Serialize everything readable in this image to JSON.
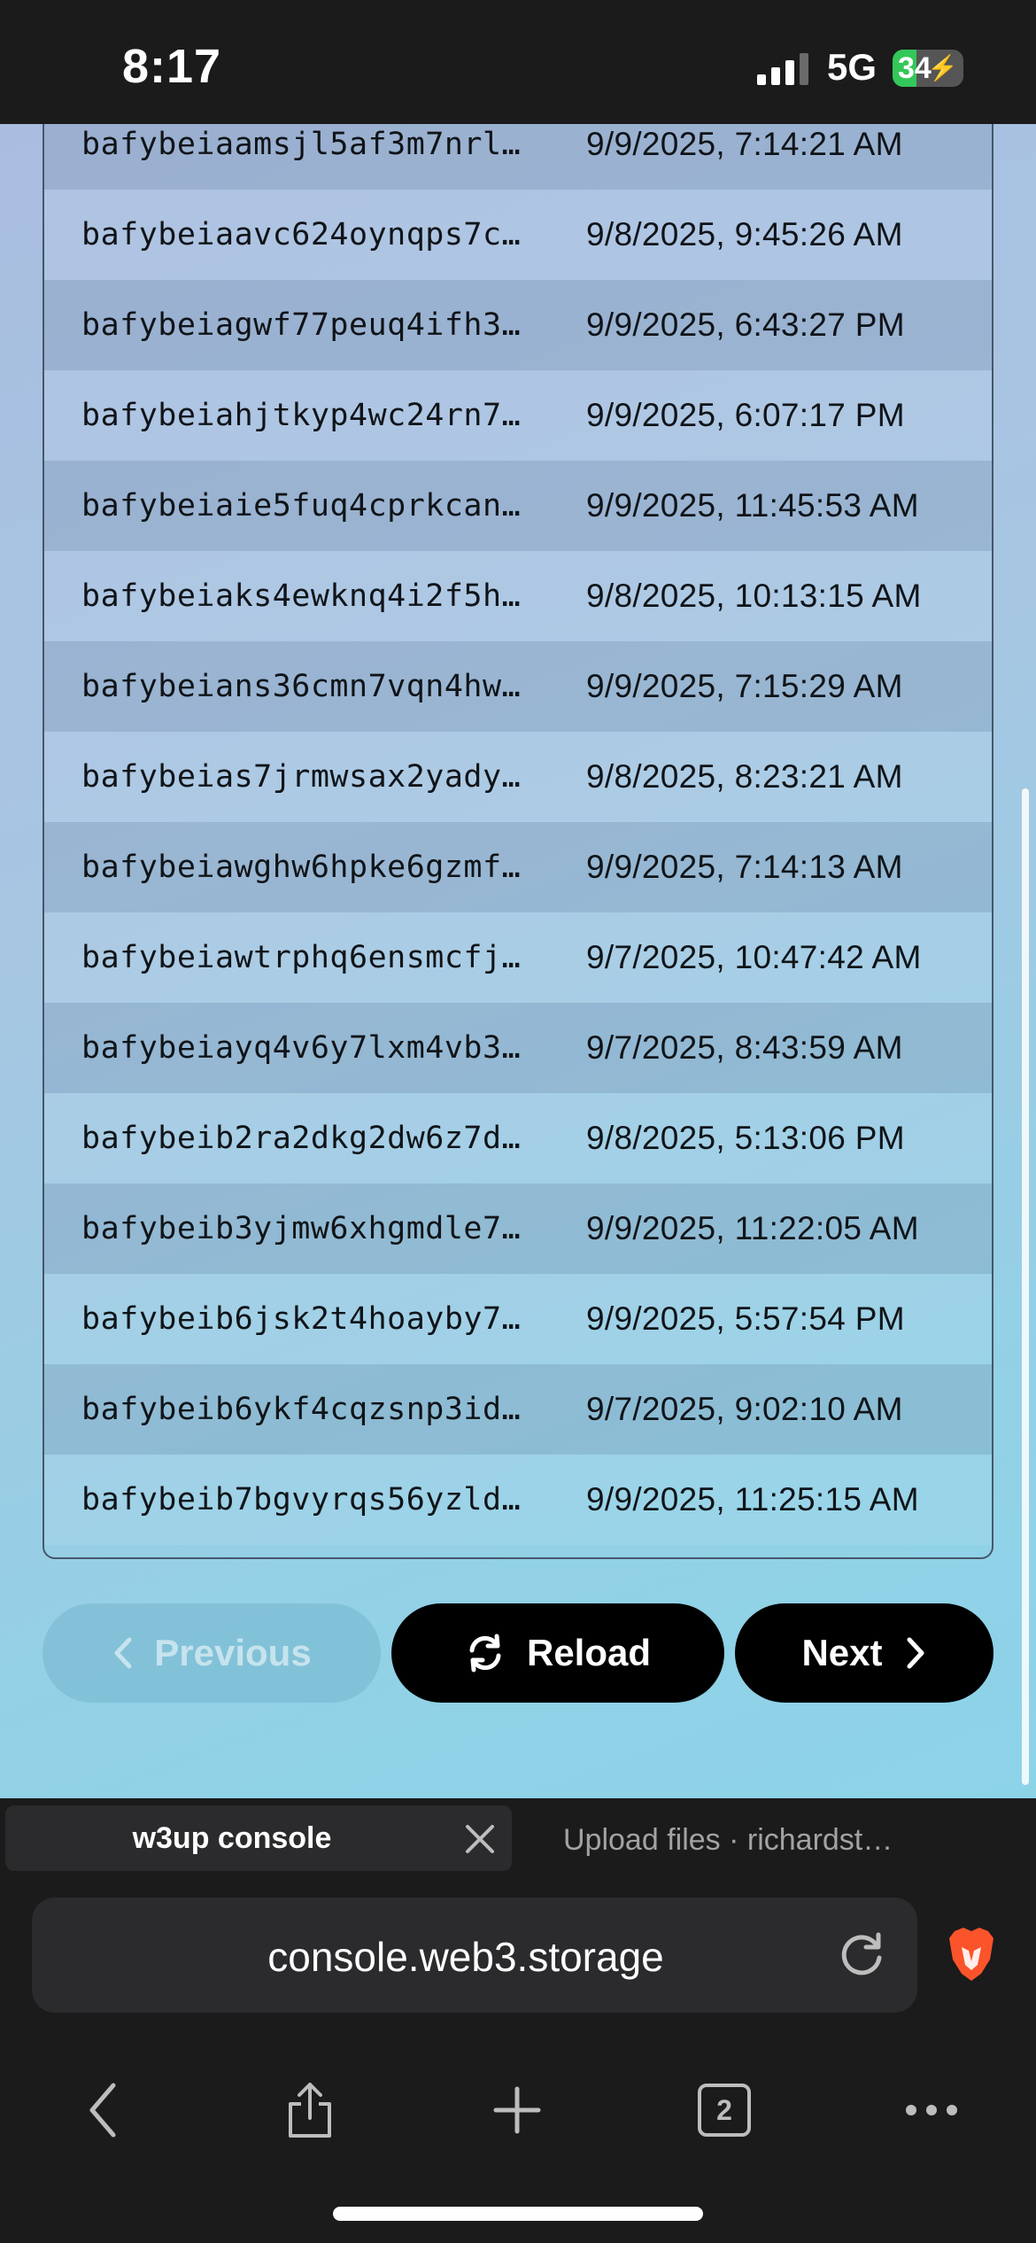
{
  "status_bar": {
    "time": "8:17",
    "network": "5G",
    "battery": "34"
  },
  "table": {
    "rows": [
      {
        "cid": "bafybeiaamsjl5af3m7nrl…",
        "date": "9/9/2025, 7:14:21 AM"
      },
      {
        "cid": "bafybeiaavc624oynqps7c…",
        "date": "9/8/2025, 9:45:26 AM"
      },
      {
        "cid": "bafybeiagwf77peuq4ifh3…",
        "date": "9/9/2025, 6:43:27 PM"
      },
      {
        "cid": "bafybeiahjtkyp4wc24rn7…",
        "date": "9/9/2025, 6:07:17 PM"
      },
      {
        "cid": "bafybeiaie5fuq4cprkcan…",
        "date": "9/9/2025, 11:45:53 AM"
      },
      {
        "cid": "bafybeiaks4ewknq4i2f5h…",
        "date": "9/8/2025, 10:13:15 AM"
      },
      {
        "cid": "bafybeians36cmn7vqn4hw…",
        "date": "9/9/2025, 7:15:29 AM"
      },
      {
        "cid": "bafybeias7jrmwsax2yady…",
        "date": "9/8/2025, 8:23:21 AM"
      },
      {
        "cid": "bafybeiawghw6hpke6gzmf…",
        "date": "9/9/2025, 7:14:13 AM"
      },
      {
        "cid": "bafybeiawtrphq6ensmcfj…",
        "date": "9/7/2025, 10:47:42 AM"
      },
      {
        "cid": "bafybeiayq4v6y7lxm4vb3…",
        "date": "9/7/2025, 8:43:59 AM"
      },
      {
        "cid": "bafybeib2ra2dkg2dw6z7d…",
        "date": "9/8/2025, 5:13:06 PM"
      },
      {
        "cid": "bafybeib3yjmw6xhgmdle7…",
        "date": "9/9/2025, 11:22:05 AM"
      },
      {
        "cid": "bafybeib6jsk2t4hoayby7…",
        "date": "9/9/2025, 5:57:54 PM"
      },
      {
        "cid": "bafybeib6ykf4cqzsnp3id…",
        "date": "9/7/2025, 9:02:10 AM"
      },
      {
        "cid": "bafybeib7bgvyrqs56yzld…",
        "date": "9/9/2025, 11:25:15 AM"
      }
    ]
  },
  "pagination": {
    "previous_label": "Previous",
    "reload_label": "Reload",
    "next_label": "Next"
  },
  "tabs": [
    {
      "title": "w3up console",
      "active": true
    },
    {
      "title": "Upload files · richardst…",
      "active": false
    }
  ],
  "browser": {
    "url": "console.web3.storage",
    "tab_count": "2"
  },
  "colors": {
    "accent_button": "#000000",
    "battery_green": "#34c759",
    "brave_orange": "#fb542b"
  },
  "icons": [
    "chevron-left-icon",
    "reload-icon",
    "chevron-right-icon",
    "close-icon",
    "refresh-icon",
    "brave-lion-icon",
    "back-icon",
    "share-icon",
    "plus-icon",
    "tabs-icon",
    "more-icon"
  ]
}
